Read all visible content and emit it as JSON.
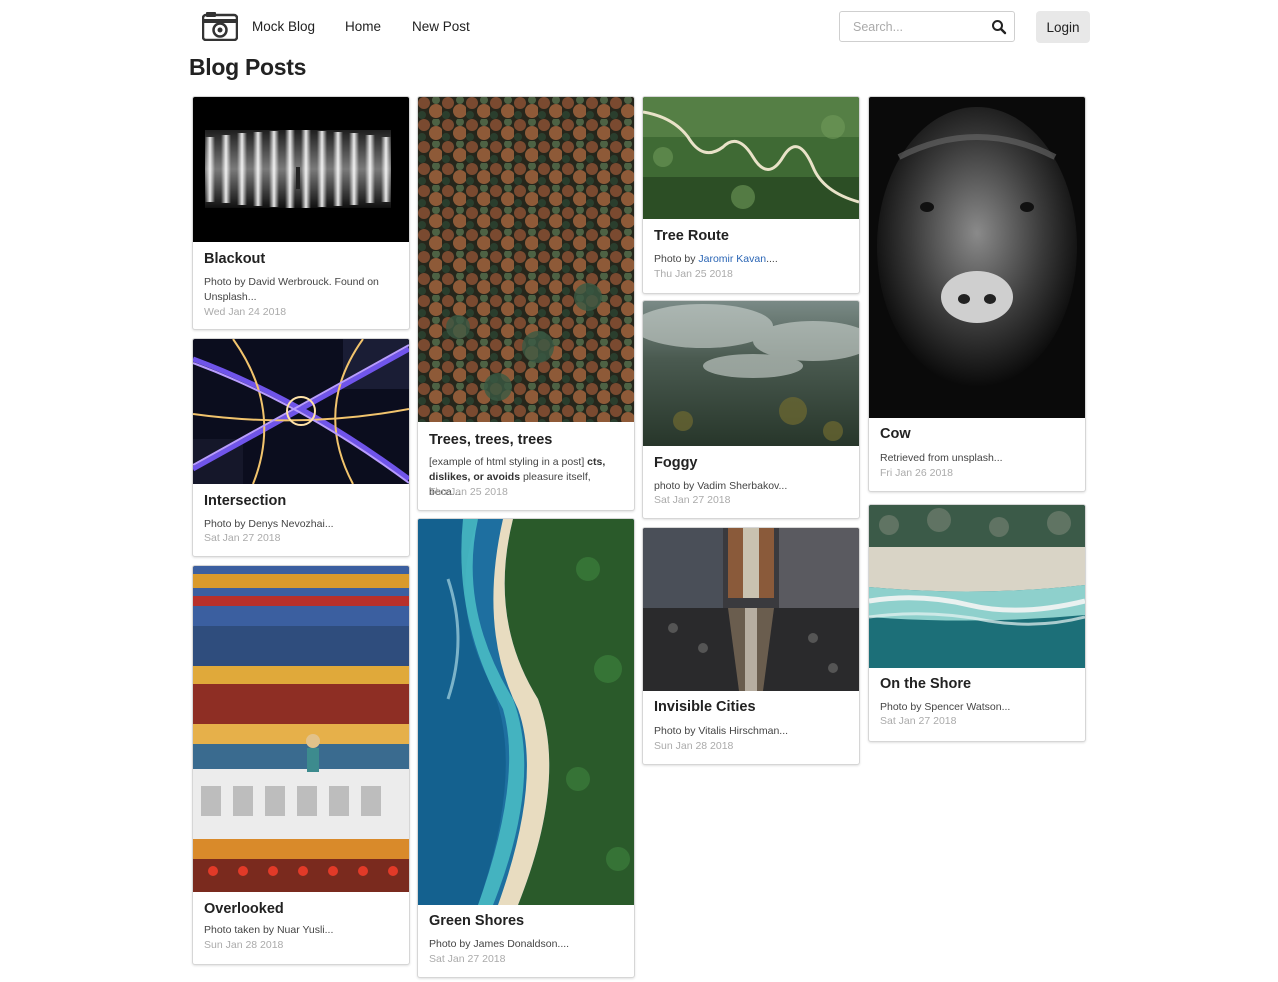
{
  "nav": {
    "brand": "Mock Blog",
    "links": [
      "Home",
      "New Post"
    ],
    "search_placeholder": "Search...",
    "login_label": "Login"
  },
  "page_title": "Blog Posts",
  "posts": [
    {
      "title": "Blackout",
      "desc": "Photo by David Werbrouck. Found on Unsplash...",
      "date": "Wed Jan 24 2018"
    },
    {
      "title": "Intersection",
      "desc": "Photo by Denys Nevozhai...",
      "date": "Sat Jan 27 2018"
    },
    {
      "title": "Overlooked",
      "desc": "Photo taken by Nuar Yusli...",
      "date": "Sun Jan 28 2018"
    },
    {
      "title": "Trees, trees, trees",
      "desc_a": "[example of html styling in a post] ",
      "desc_b": "cts, dislikes, or avoids",
      "desc_c": " pleasure itself, beca...",
      "date": "Thu Jan 25 2018"
    },
    {
      "title": "Green Shores",
      "desc": "Photo by James Donaldson....",
      "date": "Sat Jan 27 2018"
    },
    {
      "title": "Tree Route",
      "desc_a": "Photo by ",
      "link": "Jaromir Kavan",
      "desc_c": "....",
      "date": "Thu Jan 25 2018"
    },
    {
      "title": "Foggy",
      "desc": "photo by Vadim Sherbakov...",
      "date": "Sat Jan 27 2018"
    },
    {
      "title": "Invisible Cities",
      "desc": "Photo by Vitalis Hirschman...",
      "date": "Sun Jan 28 2018"
    },
    {
      "title": "Cow",
      "desc": "Retrieved from unsplash...",
      "date": "Fri Jan 26 2018"
    },
    {
      "title": "On the Shore",
      "desc": "Photo by Spencer Watson...",
      "date": "Sat Jan 27 2018"
    }
  ],
  "colors": {
    "link": "#2a65b5",
    "date": "#aaaaaa",
    "login_bg": "#e8e8e8"
  }
}
